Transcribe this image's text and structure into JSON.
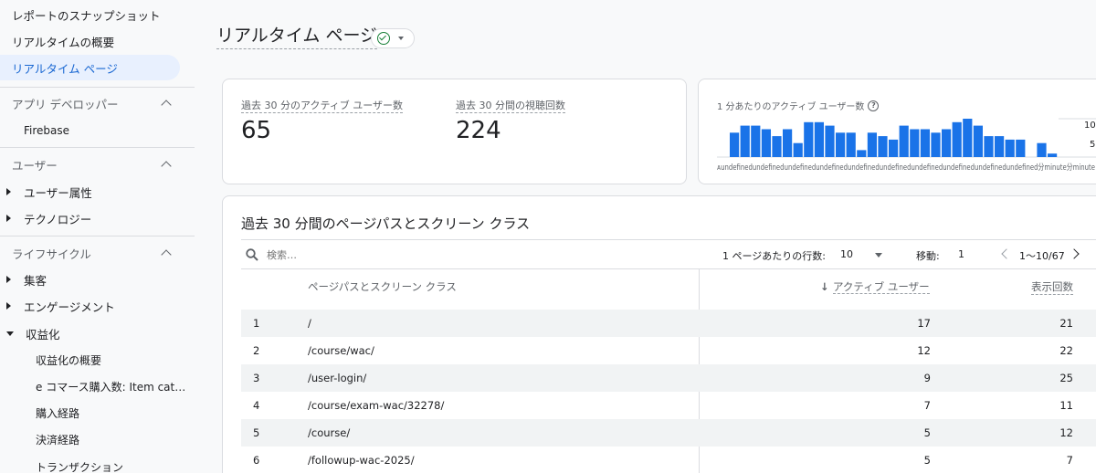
{
  "sidebar": {
    "top_items": [
      "レポートのスナップショット",
      "リアルタイムの概要",
      "リアルタイム ページ"
    ],
    "app_dev_section": "アプリ デベロッパー",
    "firebase": "Firebase",
    "user_section": "ユーザー",
    "user_items": [
      "ユーザー属性",
      "テクノロジー"
    ],
    "lifecycle_section": "ライフサイクル",
    "lifecycle_items": [
      "集客",
      "エンゲージメント"
    ],
    "monetization": "収益化",
    "monetization_items": [
      "収益化の概要",
      "e コマース購入数: Item cat…",
      "購入経路",
      "決済経路",
      "トランザクション"
    ]
  },
  "header": {
    "title": "リアルタイム ページ"
  },
  "metrics": {
    "active_users_label": "過去 30 分のアクティブ ユーザー数",
    "active_users_value": "65",
    "views_label": "過去 30 分間の視聴回数",
    "views_value": "224"
  },
  "sparkline": {
    "title": "1 分あたりのアクティブ ユーザー数",
    "help_icon": "?",
    "y_ticks": [
      "10",
      "5"
    ],
    "x_labels": "ᴀundefinedundefinedundefinedundefinedundefinedundefinedundefinedundefinedundefinedundefined分minute分minute",
    "bar_color": "#1a73e8"
  },
  "chart_data": {
    "type": "bar",
    "title": "1 分あたりのアクティブ ユーザー数",
    "values": [
      7,
      9,
      9,
      8,
      6,
      8,
      4,
      10,
      10,
      9,
      7,
      7,
      2,
      7,
      6,
      5,
      9,
      8,
      8,
      7,
      8,
      10,
      11,
      9,
      6,
      6,
      5,
      5,
      0,
      4,
      1
    ],
    "ylim": [
      0,
      11
    ],
    "y_ticks": [
      5,
      10
    ]
  },
  "table": {
    "title": "過去 30 分間のページパスとスクリーン クラス",
    "search_placeholder": "検索…",
    "rows_per_page_label": "1 ページあたりの行数:",
    "rows_per_page_value": "10",
    "goto_label": "移動:",
    "goto_value": "1",
    "pagination": "1〜10/67",
    "col_path": "ページパスとスクリーン クラス",
    "sort_arrow": "↓",
    "col_users": "アクティブ ユーザー",
    "col_views": "表示回数",
    "rows": [
      {
        "idx": "1",
        "path": "/",
        "users": "17",
        "views": "21"
      },
      {
        "idx": "2",
        "path": "/course/wac/",
        "users": "12",
        "views": "22"
      },
      {
        "idx": "3",
        "path": "/user-login/",
        "users": "9",
        "views": "25"
      },
      {
        "idx": "4",
        "path": "/course/exam-wac/32278/",
        "users": "7",
        "views": "11"
      },
      {
        "idx": "5",
        "path": "/course/",
        "users": "5",
        "views": "12"
      },
      {
        "idx": "6",
        "path": "/followup-wac-2025/",
        "users": "5",
        "views": "7"
      }
    ]
  }
}
